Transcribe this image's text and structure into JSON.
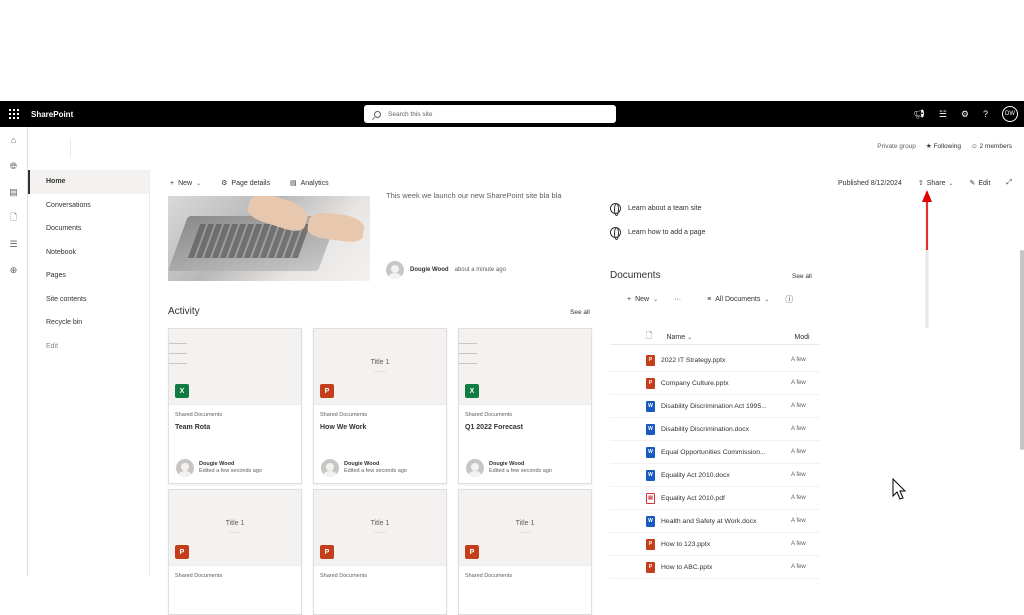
{
  "suite": {
    "brand": "SharePoint",
    "search_placeholder": "Search this site",
    "avatar": "DW"
  },
  "site": {
    "privacy": "Private group",
    "following": "Following",
    "members": "2 members"
  },
  "nav": {
    "items": [
      "Home",
      "Conversations",
      "Documents",
      "Notebook",
      "Pages",
      "Site contents",
      "Recycle bin",
      "Edit"
    ]
  },
  "command": {
    "new": "New",
    "page_details": "Page details",
    "analytics": "Analytics",
    "published": "Published 8/12/2024",
    "share": "Share",
    "edit": "Edit"
  },
  "news": {
    "text": "This week we launch our new SharePoint site bla bla",
    "author": "Dougie Wood",
    "time": "about a minute ago"
  },
  "activity": {
    "title": "Activity",
    "see_all": "See all",
    "cards": [
      {
        "thumb_title": "",
        "type": "xls",
        "library": "Shared Documents",
        "name": "Team Rota",
        "author": "Dougie Wood",
        "edited": "Edited a few seconds ago"
      },
      {
        "thumb_title": "Title 1",
        "type": "ppt",
        "library": "Shared Documents",
        "name": "How We Work",
        "author": "Dougie Wood",
        "edited": "Edited a few seconds ago"
      },
      {
        "thumb_title": "",
        "type": "xls",
        "library": "Shared Documents",
        "name": "Q1 2022 Forecast",
        "author": "Dougie Wood",
        "edited": "Edited a few seconds ago"
      },
      {
        "thumb_title": "Title 1",
        "type": "ppt",
        "library": "Shared Documents"
      },
      {
        "thumb_title": "Title 1",
        "type": "ppt",
        "library": "Shared Documents"
      },
      {
        "thumb_title": "Title 1",
        "type": "ppt",
        "library": "Shared Documents"
      }
    ]
  },
  "quicklinks": [
    "Learn about a team site",
    "Learn how to add a page"
  ],
  "documents": {
    "title": "Documents",
    "see_all": "See all",
    "new": "New",
    "more": "···",
    "view": "All Documents",
    "col_name": "Name",
    "col_modified": "Modi",
    "rows": [
      {
        "type": "ppt",
        "name": "2022 IT Strategy.pptx",
        "modified": "A few"
      },
      {
        "type": "ppt",
        "name": "Company Culture.pptx",
        "modified": "A few"
      },
      {
        "type": "doc",
        "name": "Disability Discrimination Act 1995...",
        "modified": "A few"
      },
      {
        "type": "doc",
        "name": "Disability Discrimination.docx",
        "modified": "A few"
      },
      {
        "type": "doc",
        "name": "Equal Opportunities Commission...",
        "modified": "A few"
      },
      {
        "type": "doc",
        "name": "Equality Act 2010.docx",
        "modified": "A few"
      },
      {
        "type": "pdf",
        "name": "Equality Act 2010.pdf",
        "modified": "A few"
      },
      {
        "type": "doc",
        "name": "Health and Safety at Work.docx",
        "modified": "A few"
      },
      {
        "type": "ppt",
        "name": "How to 123.pptx",
        "modified": "A few"
      },
      {
        "type": "ppt",
        "name": "How to ABC.pptx",
        "modified": "A few"
      }
    ]
  },
  "colors": {
    "suitebar": "#000000",
    "accent_arrow": "#e00000",
    "ppt": "#c43e1c",
    "xls": "#107c41",
    "doc": "#185abd"
  }
}
